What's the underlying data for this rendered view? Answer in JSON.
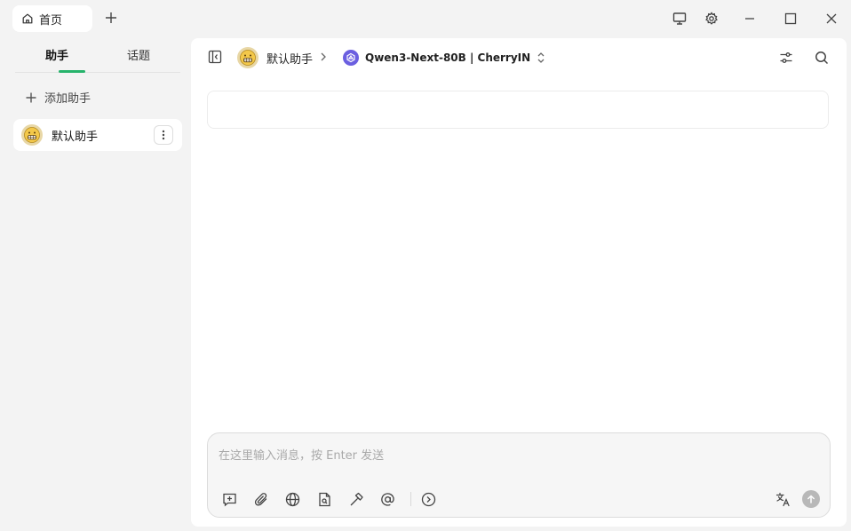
{
  "titlebar": {
    "home_tab_label": "首页",
    "icons": [
      "home-icon",
      "plus-icon",
      "monitor-icon",
      "gear-icon",
      "minimize-icon",
      "maximize-icon",
      "close-icon"
    ]
  },
  "sidebar": {
    "tabs": [
      {
        "label": "助手",
        "active": true
      },
      {
        "label": "话题",
        "active": false
      }
    ],
    "add_assistant_label": "添加助手",
    "assistants": [
      {
        "name": "默认助手"
      }
    ],
    "accent_color": "#26b36b"
  },
  "header": {
    "assistant_name": "默认助手",
    "model_name": "Qwen3-Next-80B | CherryIN"
  },
  "composer": {
    "placeholder": "在这里输入消息，按 Enter 发送",
    "value": ""
  }
}
